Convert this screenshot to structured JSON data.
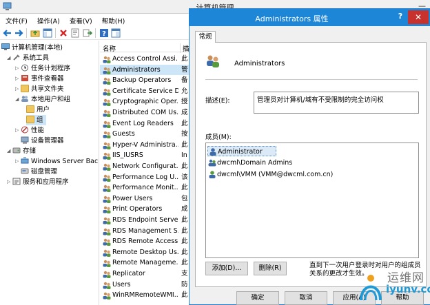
{
  "window": {
    "title": "计算机管理"
  },
  "menu": [
    "文件(F)",
    "操作(A)",
    "查看(V)",
    "帮助(H)"
  ],
  "tree": {
    "items": [
      {
        "label": "计算机管理(本地)",
        "indent": 0,
        "exp": ""
      },
      {
        "label": "系统工具",
        "indent": 1,
        "exp": "◢"
      },
      {
        "label": "任务计划程序",
        "indent": 2,
        "exp": "▷"
      },
      {
        "label": "事件查看器",
        "indent": 2,
        "exp": "▷"
      },
      {
        "label": "共享文件夹",
        "indent": 2,
        "exp": "▷"
      },
      {
        "label": "本地用户和组",
        "indent": 2,
        "exp": "◢"
      },
      {
        "label": "用户",
        "indent": 3,
        "exp": ""
      },
      {
        "label": "组",
        "indent": 3,
        "exp": ""
      },
      {
        "label": "性能",
        "indent": 2,
        "exp": "▷"
      },
      {
        "label": "设备管理器",
        "indent": 2,
        "exp": ""
      },
      {
        "label": "存储",
        "indent": 1,
        "exp": "◢"
      },
      {
        "label": "Windows Server Back",
        "indent": 2,
        "exp": "▷"
      },
      {
        "label": "磁盘管理",
        "indent": 2,
        "exp": ""
      },
      {
        "label": "服务和应用程序",
        "indent": 1,
        "exp": "▷"
      }
    ]
  },
  "list": {
    "col_name": "名称",
    "col_desc": "描",
    "rows": [
      {
        "name": "Access Control Assi...",
        "desc": "此"
      },
      {
        "name": "Administrators",
        "desc": "管"
      },
      {
        "name": "Backup Operators",
        "desc": "备"
      },
      {
        "name": "Certificate Service D...",
        "desc": "允"
      },
      {
        "name": "Cryptographic Oper...",
        "desc": "授"
      },
      {
        "name": "Distributed COM Us...",
        "desc": "成"
      },
      {
        "name": "Event Log Readers",
        "desc": "此"
      },
      {
        "name": "Guests",
        "desc": "按"
      },
      {
        "name": "Hyper-V Administra...",
        "desc": "此"
      },
      {
        "name": "IIS_IUSRS",
        "desc": "In"
      },
      {
        "name": "Network Configurat...",
        "desc": "此"
      },
      {
        "name": "Performance Log U...",
        "desc": "该"
      },
      {
        "name": "Performance Monit...",
        "desc": "此"
      },
      {
        "name": "Power Users",
        "desc": "包"
      },
      {
        "name": "Print Operators",
        "desc": "成"
      },
      {
        "name": "RDS Endpoint Serve...",
        "desc": "此"
      },
      {
        "name": "RDS Management S...",
        "desc": "此"
      },
      {
        "name": "RDS Remote Access...",
        "desc": "此"
      },
      {
        "name": "Remote Desktop Us...",
        "desc": "此"
      },
      {
        "name": "Remote Manageme...",
        "desc": "此"
      },
      {
        "name": "Replicator",
        "desc": "支"
      },
      {
        "name": "Users",
        "desc": "防"
      },
      {
        "name": "WinRMRemoteWMI...",
        "desc": "此"
      }
    ]
  },
  "dialog": {
    "title": "Administrators 属性",
    "help": "?",
    "close": "✕",
    "tab": "常规",
    "group_name": "Administrators",
    "desc_label": "描述(E):",
    "desc_value": "管理员对计算机/域有不受限制的完全访问权",
    "members_label": "成员(M):",
    "members": [
      "Administrator",
      "dwcml\\Domain Admins",
      "dwcml\\VMM (VMM@dwcml.com.cn)"
    ],
    "add": "添加(D)...",
    "remove": "删除(R)",
    "note": "直到下一次用户登录时对用户的组成员关系的更改才生效。",
    "ok": "确定",
    "cancel": "取消",
    "apply": "应用(A)",
    "help_btn": "帮助"
  },
  "watermark": {
    "cn": "运维网",
    "en": "iyunv.com"
  }
}
